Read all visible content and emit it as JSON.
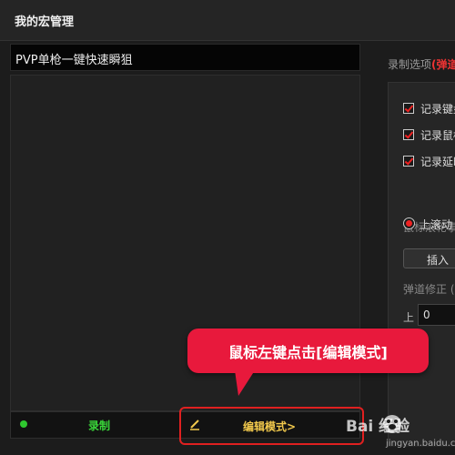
{
  "window": {
    "title": "我的宏管理"
  },
  "macro": {
    "name": "PVP单枪一键快速瞬狙"
  },
  "bottom_bar": {
    "record_label": "录制",
    "edit_label": "编辑模式>"
  },
  "right_panel": {
    "options_label": "录制选项",
    "options_highlight": "(弹道",
    "checkboxes": [
      "记录键盘",
      "记录鼠标",
      "记录延时"
    ],
    "scroll_label": "鼠标滚轮事件",
    "radio_label": "上滚动",
    "insert_label": "插入",
    "recoil_label": "弹道修正 (←",
    "up_label": "上",
    "up_value": "0"
  },
  "callout": {
    "text": "鼠标左键点击[编辑模式]"
  },
  "watermark": {
    "brand": "Bai  经验",
    "url": "jingyan.baidu.com"
  },
  "colors": {
    "accent_red": "#e22222",
    "record_green": "#39d639",
    "edit_yellow": "#f2c94c",
    "callout": "#e8193c"
  }
}
